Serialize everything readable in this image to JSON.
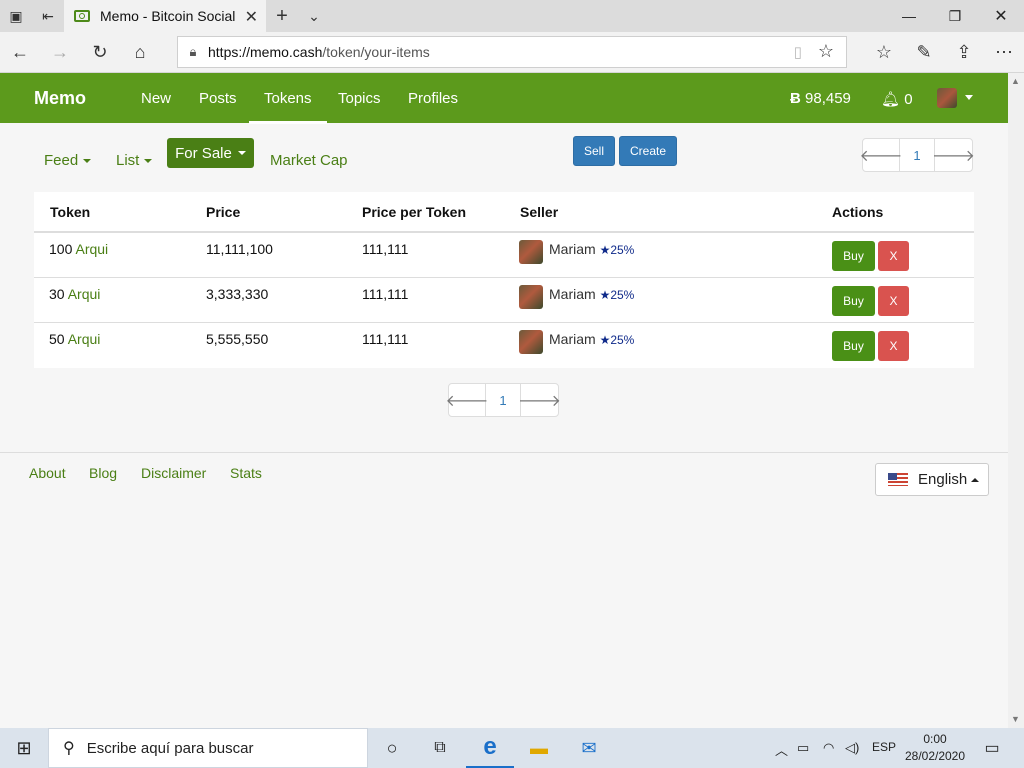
{
  "browser": {
    "tab_title": "Memo - Bitcoin Social N",
    "url_host": "https://memo.cash",
    "url_path": "/token/your-items"
  },
  "nav": {
    "brand": "Memo",
    "links": [
      "New",
      "Posts",
      "Tokens",
      "Topics",
      "Profiles"
    ],
    "active": "Tokens",
    "balance": "98,459",
    "notifications": "0"
  },
  "subnav": {
    "feed": "Feed",
    "list": "List",
    "for_sale": "For Sale",
    "market_cap": "Market Cap",
    "sell": "Sell",
    "create": "Create",
    "page": "1"
  },
  "table": {
    "headers": [
      "Token",
      "Price",
      "Price per Token",
      "Seller",
      "Actions"
    ],
    "rows": [
      {
        "amount": "100",
        "token": "Arqui",
        "price": "11,111,100",
        "ppt": "111,111",
        "seller": "Mariam",
        "rep": "25%",
        "buy": "Buy",
        "cancel": "X"
      },
      {
        "amount": "30",
        "token": "Arqui",
        "price": "3,333,330",
        "ppt": "111,111",
        "seller": "Mariam",
        "rep": "25%",
        "buy": "Buy",
        "cancel": "X"
      },
      {
        "amount": "50",
        "token": "Arqui",
        "price": "5,555,550",
        "ppt": "111,111",
        "seller": "Mariam",
        "rep": "25%",
        "buy": "Buy",
        "cancel": "X"
      }
    ]
  },
  "bottom_pager": {
    "page": "1"
  },
  "footer": {
    "links": [
      "About",
      "Blog",
      "Disclaimer",
      "Stats"
    ],
    "language": "English"
  },
  "taskbar": {
    "search_placeholder": "Escribe aquí para buscar",
    "lang": "ESP",
    "time": "0:00",
    "date": "28/02/2020"
  },
  "colors": {
    "brand_green": "#5c9a1c",
    "link_green": "#4a7f15",
    "primary_blue": "#337ab7",
    "danger": "#d9534f"
  }
}
